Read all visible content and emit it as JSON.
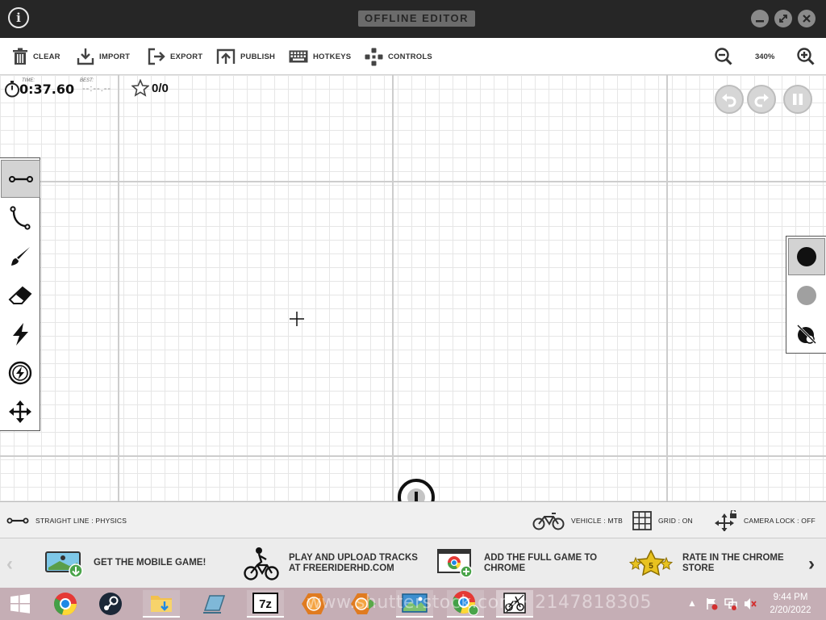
{
  "window": {
    "title": "OFFLINE EDITOR",
    "info": "i",
    "controls": [
      "minimize",
      "maximize",
      "close"
    ]
  },
  "toolbar": {
    "items": [
      {
        "label": "CLEAR",
        "icon": "trash-icon"
      },
      {
        "label": "IMPORT",
        "icon": "import-icon"
      },
      {
        "label": "EXPORT",
        "icon": "export-icon"
      },
      {
        "label": "PUBLISH",
        "icon": "publish-icon"
      },
      {
        "label": "HOTKEYS",
        "icon": "keyboard-icon"
      },
      {
        "label": "CONTROLS",
        "icon": "gamepad-icon"
      }
    ],
    "zoom": "340%"
  },
  "hud": {
    "time_label": "TIME:",
    "time": "0:37.60",
    "best_label": "BEST:",
    "best": "--:--.--",
    "stars": "0/0"
  },
  "tools": [
    {
      "name": "straight-line-tool",
      "icon": "straight-line-icon",
      "active": true
    },
    {
      "name": "curve-tool",
      "icon": "curve-icon",
      "active": false
    },
    {
      "name": "brush-tool",
      "icon": "brush-icon",
      "active": false
    },
    {
      "name": "eraser-tool",
      "icon": "eraser-icon",
      "active": false
    },
    {
      "name": "powerup-tool",
      "icon": "lightning-icon",
      "active": false
    },
    {
      "name": "special-tool",
      "icon": "lightning-circle-icon",
      "active": false
    },
    {
      "name": "move-tool",
      "icon": "move-icon",
      "active": false
    }
  ],
  "colors": {
    "physics": "#111111",
    "scenery": "#a0a0a0",
    "titlebar": "#262626",
    "taskbar": "#c5aeb5"
  },
  "statusbar": {
    "tool": "STRAIGHT LINE : PHYSICS",
    "vehicle": "VEHICLE : MTB",
    "grid": "GRID : ON",
    "camera": "CAMERA LOCK : OFF"
  },
  "promo": {
    "items": [
      {
        "line1": "GET THE MOBILE GAME!",
        "line2": ""
      },
      {
        "line1": "PLAY AND UPLOAD TRACKS",
        "line2": "AT FREERIDERHD.COM"
      },
      {
        "line1": "ADD THE FULL GAME TO",
        "line2": "CHROME"
      },
      {
        "line1": "RATE IN THE CHROME",
        "line2": "STORE"
      }
    ],
    "rating_badge": "5"
  },
  "taskbar": {
    "watermark": "www.shutterstock.com · 2147818305",
    "time": "9:44 PM",
    "date": "2/20/2022"
  }
}
